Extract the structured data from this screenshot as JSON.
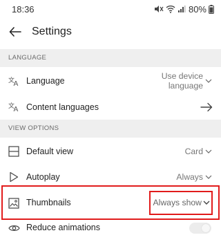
{
  "status_bar": {
    "time": "18:36",
    "battery": "80%",
    "icons": [
      "mute-icon",
      "wifi-icon",
      "signal-icon",
      "battery-icon"
    ]
  },
  "app_bar": {
    "back_icon": "arrow-left-icon",
    "title": "Settings"
  },
  "sections": {
    "language": {
      "header": "LANGUAGE",
      "language": {
        "label": "Language",
        "value_line1": "Use device",
        "value_line2": "language",
        "icon": "translate-icon"
      },
      "content_languages": {
        "label": "Content languages",
        "icon": "translate-icon",
        "action_icon": "arrow-right-icon"
      }
    },
    "view_options": {
      "header": "VIEW OPTIONS",
      "default_view": {
        "label": "Default view",
        "value": "Card",
        "icon": "view-layout-icon"
      },
      "autoplay": {
        "label": "Autoplay",
        "value": "Always",
        "icon": "play-icon"
      },
      "thumbnails": {
        "label": "Thumbnails",
        "value": "Always show",
        "icon": "image-icon"
      },
      "reduce_animations": {
        "label": "Reduce animations",
        "icon": "eye-icon",
        "toggle_on": false
      }
    }
  },
  "colors": {
    "highlight": "#e11b1b",
    "section_bg": "#efefef",
    "secondary_text": "#777777"
  }
}
